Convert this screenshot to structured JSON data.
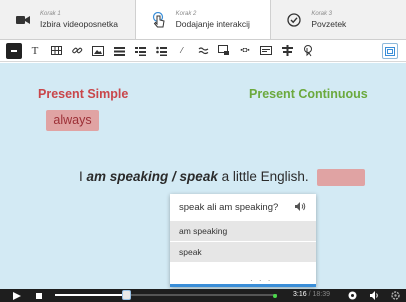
{
  "steps": [
    {
      "small": "Korak 1",
      "title": "Izbira videoposnetka"
    },
    {
      "small": "Korak 2",
      "title": "Dodajanje interakcij"
    },
    {
      "small": "Korak 3",
      "title": "Povzetek"
    }
  ],
  "toolbar": {
    "icons": [
      "label-icon",
      "text-icon",
      "table-icon",
      "link-icon",
      "image-icon",
      "statements-icon",
      "single-choice-icon",
      "multiple-choice-icon",
      "true-false-icon",
      "fill-blanks-icon",
      "drag-text-icon",
      "mark-words-icon",
      "drag-drop-icon",
      "crossroads-icon",
      "navigation-hotspot-icon",
      "fullscreen-icon"
    ]
  },
  "stage": {
    "heading_left": "Present Simple",
    "heading_right": "Present Continuous",
    "keyword": "always",
    "sentence_start": "I ",
    "sentence_bold": "am speaking / speak",
    "sentence_end": " a little English."
  },
  "popup": {
    "question": "speak ali am speaking?",
    "options": [
      "am speaking",
      "speak"
    ],
    "dots": "· · ·"
  },
  "player": {
    "current_time": "3:16",
    "total_time": "18:39",
    "progress": 0.32
  },
  "colors": {
    "stage_bg": "#d3eaf4",
    "present_simple": "#c9464a",
    "present_continuous": "#6ba93d",
    "highlight": "#e0a3a3",
    "accent": "#3a8ed8"
  }
}
